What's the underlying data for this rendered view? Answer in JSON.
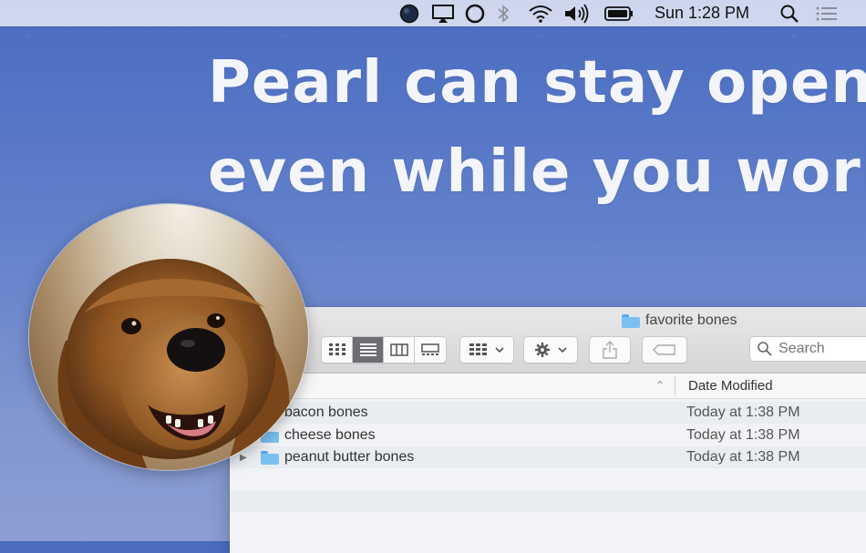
{
  "menubar": {
    "clock": "Sun 1:28 PM",
    "icons": [
      "pearl-app-icon",
      "airplay-icon",
      "siri-icon",
      "bluetooth-icon",
      "wifi-icon",
      "volume-icon",
      "battery-icon",
      "spotlight-search-icon",
      "notification-center-icon"
    ]
  },
  "headline": {
    "line1": "Pearl can stay open,",
    "line2": "even while you work"
  },
  "finder": {
    "title": "favorite bones",
    "search_placeholder": "Search",
    "column_header": "Date Modified",
    "rows": [
      {
        "name": "bacon bones",
        "date": "Today at 1:38 PM"
      },
      {
        "name": "cheese bones",
        "date": "Today at 1:38 PM"
      },
      {
        "name": "peanut butter bones",
        "date": "Today at 1:38 PM"
      }
    ]
  },
  "colors": {
    "sky_top": "#4a6cc0",
    "sky_bottom": "#8d9ed3",
    "folder_blue": "#7cc0f2",
    "selected_segment": "#6d6d72"
  }
}
